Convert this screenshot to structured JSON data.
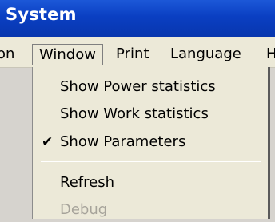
{
  "window": {
    "title": "System"
  },
  "menubar": {
    "items": [
      {
        "label": "on"
      },
      {
        "label": "Window"
      },
      {
        "label": "Print"
      },
      {
        "label": "Language"
      },
      {
        "label": "H"
      }
    ]
  },
  "window_menu": {
    "items": [
      {
        "label": "Show Power statistics",
        "checked": false,
        "enabled": true
      },
      {
        "label": "Show Work statistics",
        "checked": false,
        "enabled": true
      },
      {
        "label": "Show Parameters",
        "checked": true,
        "enabled": true
      },
      {
        "label": "Refresh",
        "checked": false,
        "enabled": true
      },
      {
        "label": "Debug",
        "checked": false,
        "enabled": false
      }
    ],
    "check_glyph": "✔",
    "check_icon": "checkmark-icon"
  }
}
